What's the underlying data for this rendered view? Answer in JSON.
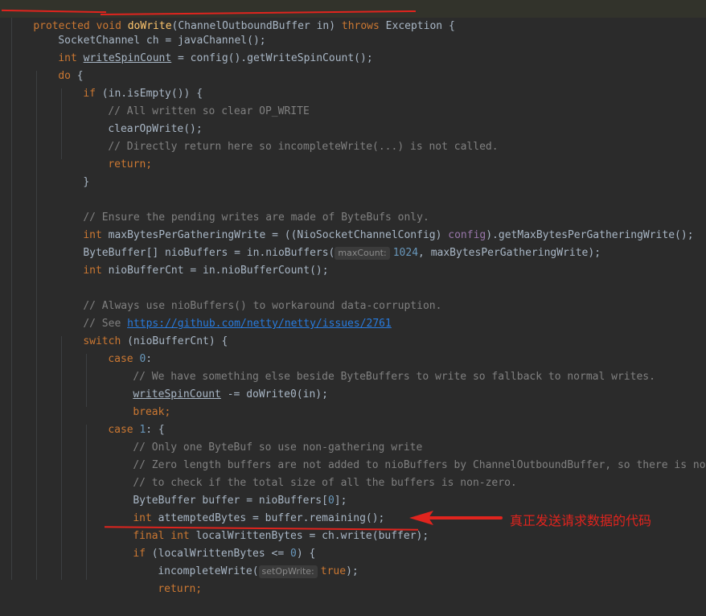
{
  "code": {
    "signature": {
      "mod1": "protected",
      "mod2": "void",
      "method": "doWrite",
      "open": "(",
      "ptype": "ChannelOutboundBuffer",
      "pname": "in",
      "close": ")",
      "throws": "throws",
      "exc": "Exception",
      "brace": "{"
    },
    "l1": "SocketChannel ch = javaChannel();",
    "l2_kw": "int",
    "l2_var": "writeSpinCount",
    "l2_rest": " = config().getWriteSpinCount();",
    "l3_kw": "do",
    "l3_rest": " {",
    "l4_kw": "if",
    "l4_rest": " (in.isEmpty()) {",
    "l5": "// All written so clear OP_WRITE",
    "l6": "clearOpWrite();",
    "l7": "// Directly return here so incompleteWrite(...) is not called.",
    "l8": "return;",
    "l9": "}",
    "l11": "// Ensure the pending writes are made of ByteBufs only.",
    "l12_kw": "int",
    "l12_a": " maxBytesPerGatheringWrite = ((NioSocketChannelConfig) ",
    "l12_fld": "config",
    "l12_b": ").getMaxBytesPerGatheringWrite();",
    "l13_a": "ByteBuffer[] nioBuffers = in.nioBuffers(",
    "l13_hint": "maxCount:",
    "l13_num": "1024",
    "l13_b": ", maxBytesPerGatheringWrite);",
    "l14_kw": "int",
    "l14_rest": " nioBufferCnt = in.nioBufferCount();",
    "l16": "// Always use nioBuffers() to workaround data-corruption.",
    "l17_cm": "// See ",
    "l17_link": "https://github.com/netty/netty/issues/2761",
    "l18_kw": "switch",
    "l18_rest": " (nioBufferCnt) {",
    "l19_kw": "case",
    "l19_num": "0",
    "l19_rest": ":",
    "l20": "// We have something else beside ByteBuffers to write so fallback to normal writes.",
    "l21_var": "writeSpinCount",
    "l21_rest": " -= doWrite0(in);",
    "l22": "break;",
    "l23_kw": "case",
    "l23_num": "1",
    "l23_rest": ": {",
    "l24": "// Only one ByteBuf so use non-gathering write",
    "l25": "// Zero length buffers are not added to nioBuffers by ChannelOutboundBuffer, so there is no need",
    "l26": "// to check if the total size of all the buffers is non-zero.",
    "l27_a": "ByteBuffer buffer = nioBuffers[",
    "l27_num": "0",
    "l27_b": "];",
    "l28_kw": "int",
    "l28_rest": " attemptedBytes = buffer.remaining();",
    "l29_kw": "final int",
    "l29_rest": " localWrittenBytes = ch.write(buffer);",
    "l30_kw": "if",
    "l30_a": " (localWrittenBytes <= ",
    "l30_num": "0",
    "l30_b": ") {",
    "l31_a": "incompleteWrite(",
    "l31_hint": "setOpWrite:",
    "l31_kw": "true",
    "l31_b": ");",
    "l32": "return;"
  },
  "annotation": {
    "text": "真正发送请求数据的代码",
    "color": "#e0241e"
  }
}
